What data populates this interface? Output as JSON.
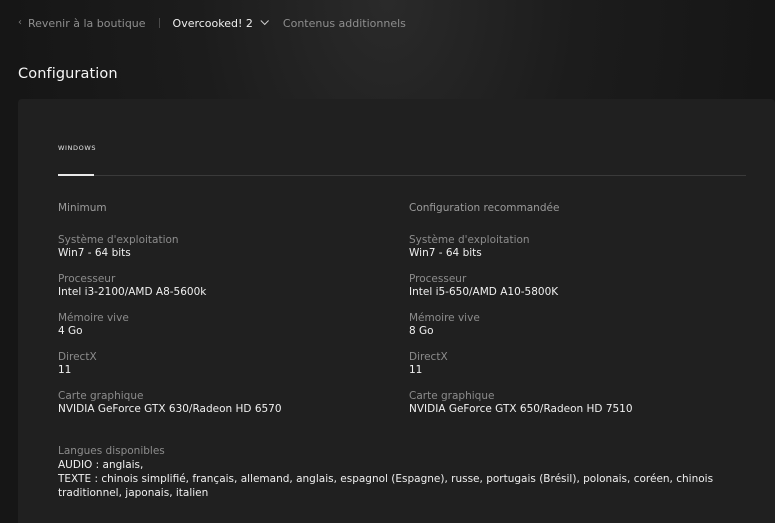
{
  "nav": {
    "back_label": "Revenir à la boutique",
    "product_label": "Overcooked! 2",
    "addons_label": "Contenus additionnels"
  },
  "section": {
    "title": "Configuration"
  },
  "tabs": [
    {
      "label": "WINDOWS",
      "active": true
    }
  ],
  "minimum": {
    "heading": "Minimum",
    "specs": [
      {
        "label": "Système d'exploitation",
        "value": "Win7 - 64 bits"
      },
      {
        "label": "Processeur",
        "value": "Intel i3-2100/AMD A8-5600k"
      },
      {
        "label": "Mémoire vive",
        "value": "4 Go"
      },
      {
        "label": "DirectX",
        "value": "11"
      },
      {
        "label": "Carte graphique",
        "value": "NVIDIA GeForce GTX 630/Radeon HD 6570"
      }
    ]
  },
  "recommended": {
    "heading": "Configuration recommandée",
    "specs": [
      {
        "label": "Système d'exploitation",
        "value": "Win7 - 64 bits"
      },
      {
        "label": "Processeur",
        "value": "Intel i5-650/AMD A10-5800K"
      },
      {
        "label": "Mémoire vive",
        "value": "8 Go"
      },
      {
        "label": "DirectX",
        "value": "11"
      },
      {
        "label": "Carte graphique",
        "value": "NVIDIA GeForce GTX 650/Radeon HD 7510"
      }
    ]
  },
  "languages": {
    "label": "Langues disponibles",
    "audio": "AUDIO : anglais,",
    "text": "TEXTE : chinois simplifié, français, allemand, anglais, espagnol (Espagne), russe, portugais (Brésil), polonais, coréen, chinois traditionnel, japonais, italien"
  }
}
